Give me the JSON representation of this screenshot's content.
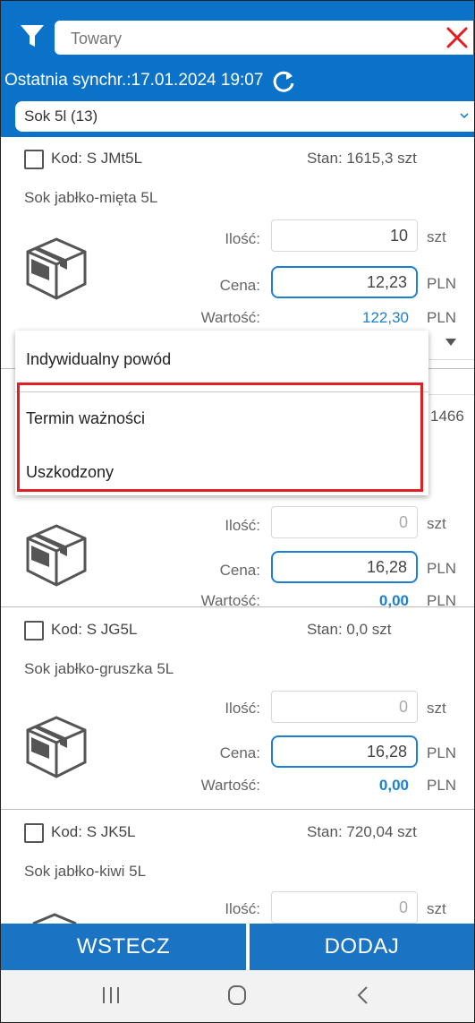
{
  "header": {
    "search_placeholder": "Towary",
    "sync_label": "Ostatnia synchr.:17.01.2024 19:07",
    "category": "Sok 5l (13)"
  },
  "products": [
    {
      "code": "Kod: S JMt5L",
      "stock": "Stan: 1615,3 szt",
      "name": "Sok jabłko-mięta 5L",
      "qty_label": "Ilość:",
      "qty": "10",
      "qty_unit": "szt",
      "price_label": "Cena:",
      "price": "12,23",
      "price_unit": "PLN",
      "value_label": "Wartość:",
      "value": "122,30",
      "value_unit": "PLN"
    },
    {
      "stock_partial": "1466",
      "qty_label": "Ilość:",
      "qty": "0",
      "qty_unit": "szt",
      "price_label": "Cena:",
      "price": "16,28",
      "price_unit": "PLN",
      "value_label": "Wartość:",
      "value": "0,00",
      "value_unit": "PLN"
    },
    {
      "code": "Kod: S JG5L",
      "stock": "Stan: 0,0 szt",
      "name": "Sok jabłko-gruszka 5L",
      "qty_label": "Ilość:",
      "qty": "0",
      "qty_unit": "szt",
      "price_label": "Cena:",
      "price": "16,28",
      "price_unit": "PLN",
      "value_label": "Wartość:",
      "value": "0,00",
      "value_unit": "PLN"
    },
    {
      "code": "Kod: S JK5L",
      "stock": "Stan: 720,04 szt",
      "name": "Sok jabłko-kiwi 5L",
      "qty_label": "Ilość:",
      "qty": "0",
      "qty_unit": "szt"
    }
  ],
  "dropdown": {
    "options": [
      "Indywidualny powód",
      "Termin ważności",
      "Uszkodzony"
    ]
  },
  "buttons": {
    "back": "WSTECZ",
    "add": "DODAJ"
  },
  "colors": {
    "primary": "#0a73c9",
    "accent_blue": "#1e7fd1",
    "highlight_red": "#e01f24"
  }
}
